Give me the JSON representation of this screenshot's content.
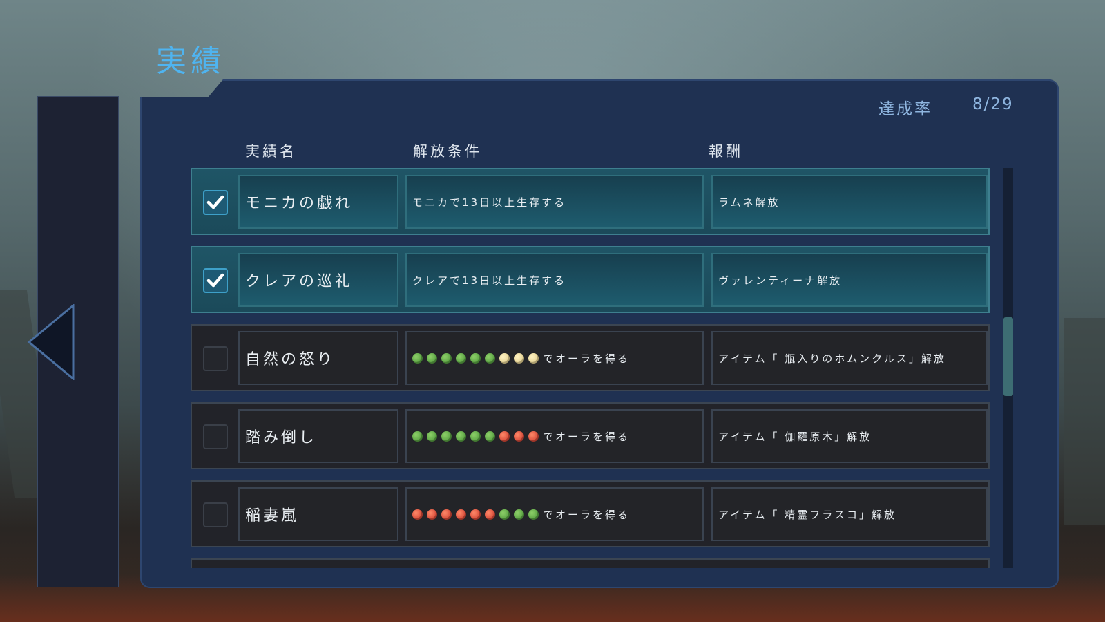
{
  "screen_title": "実績",
  "completion": {
    "label": "達成率",
    "value": "8/29"
  },
  "columns": {
    "name": "実績名",
    "condition": "解放条件",
    "reward": "報酬"
  },
  "rows": [
    {
      "done": true,
      "name": "モニカの戯れ",
      "condition_text": "モニカで13日以上生存する",
      "orbs": [],
      "reward": "ラムネ解放"
    },
    {
      "done": true,
      "name": "クレアの巡礼",
      "condition_text": "クレアで13日以上生存する",
      "orbs": [],
      "reward": "ヴァレンティーナ解放"
    },
    {
      "done": false,
      "name": "自然の怒り",
      "condition_text": "でオーラを得る",
      "orbs": [
        "green",
        "green",
        "green",
        "green",
        "green",
        "green",
        "yellow",
        "yellow",
        "yellow"
      ],
      "reward": "アイテム「 瓶入りのホムンクルス」解放"
    },
    {
      "done": false,
      "name": "踏み倒し",
      "condition_text": "でオーラを得る",
      "orbs": [
        "green",
        "green",
        "green",
        "green",
        "green",
        "green",
        "red",
        "red",
        "red"
      ],
      "reward": "アイテム「 伽羅原木」解放"
    },
    {
      "done": false,
      "name": "稲妻嵐",
      "condition_text": "でオーラを得る",
      "orbs": [
        "red",
        "red",
        "red",
        "red",
        "red",
        "red",
        "green",
        "green",
        "green"
      ],
      "reward": "アイテム「 精霊フラスコ」解放"
    }
  ],
  "colors": {
    "title": "#4fb4f0",
    "completed_row": "#1f5566",
    "panel": "#1f3152"
  }
}
